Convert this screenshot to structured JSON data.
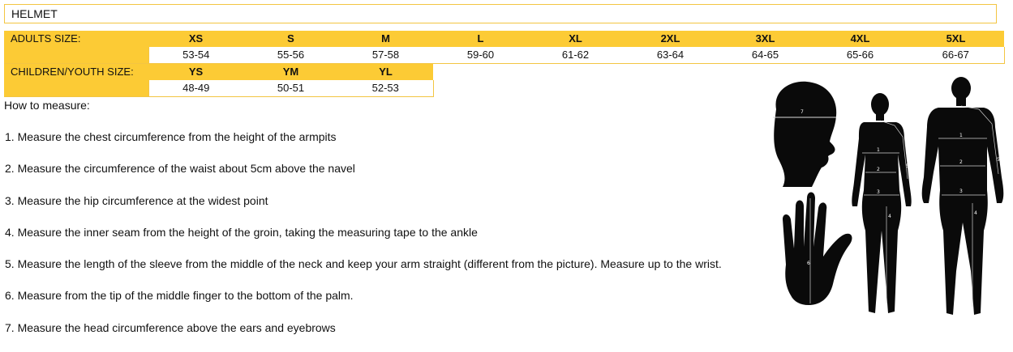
{
  "title": "HELMET",
  "adults": {
    "label": "ADULTS SIZE:",
    "sizes": [
      "XS",
      "S",
      "M",
      "L",
      "XL",
      "2XL",
      "3XL",
      "4XL",
      "5XL"
    ],
    "ranges": [
      "53-54",
      "55-56",
      "57-58",
      "59-60",
      "61-62",
      "63-64",
      "64-65",
      "65-66",
      "66-67"
    ]
  },
  "children": {
    "label": "CHILDREN/YOUTH SIZE:",
    "sizes": [
      "YS",
      "YM",
      "YL"
    ],
    "ranges": [
      "48-49",
      "50-51",
      "52-53"
    ]
  },
  "how_to_measure": "How to measure:",
  "steps": [
    "1. Measure the chest circumference from the height of the armpits",
    "2. Measure the circumference of the waist about 5cm above the navel",
    "3. Measure the hip circumference at the widest point",
    "4. Measure the inner seam from the height of the groin, taking the measuring tape to the ankle",
    "5. Measure the length of the sleeve from the middle of the neck and keep your arm straight (different from the picture). Measure up to the wrist.",
    "6. Measure from the tip of the middle finger to the bottom of the palm.",
    "7. Measure the head circumference above the ears and eyebrows"
  ],
  "figure_marks": {
    "head": "7",
    "hand": "6",
    "woman": [
      "1",
      "2",
      "3",
      "4",
      "5"
    ],
    "man": [
      "1",
      "2",
      "3",
      "4",
      "5"
    ]
  },
  "colors": {
    "accent": "#fccb35",
    "border": "#f3c542",
    "silhouette": "#0a0a0a"
  }
}
